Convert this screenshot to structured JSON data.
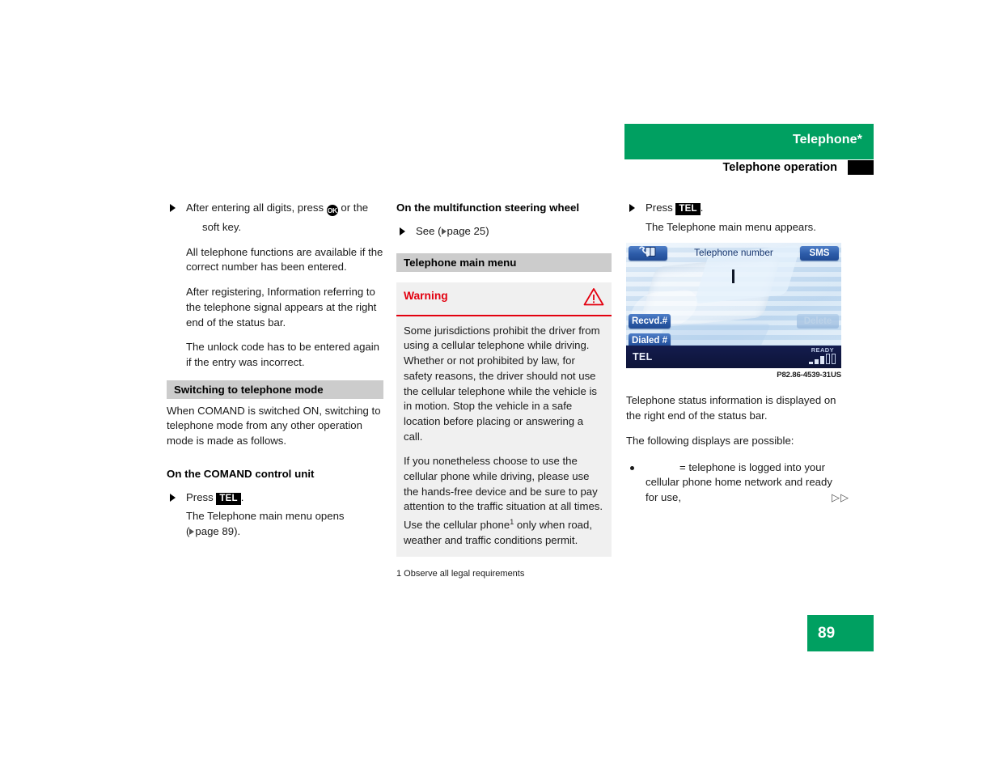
{
  "header": {
    "chapter_title": "Telephone*",
    "section_title": "Telephone operation",
    "green": "#00a061"
  },
  "left_column": {
    "step1": {
      "pre": "After entering all digits, press",
      "key": "OK",
      "post": "or the",
      "line2": "soft key."
    },
    "para1": "All telephone functions are available if the correct number has been entered.",
    "para2": "After registering, Information referring to the telephone signal appears at the right end of the status bar.",
    "para3": "The unlock code has to be entered again if the entry was incorrect.",
    "section_head": "Switching to telephone mode",
    "para4": "When COMAND is switched ON, switching to telephone mode from any other operation mode is made as follows.",
    "sub_head": "On the COMAND control unit",
    "step2": {
      "pre": "Press",
      "key": "TEL",
      "post": "."
    },
    "step2_result_line1": "The Telephone main menu opens",
    "step2_result_line2": "page 89)."
  },
  "middle_column": {
    "head": "On the multifunction steering wheel",
    "see_step": {
      "pre": "See (",
      "post": "page 25)"
    },
    "section_head": "Telephone main menu",
    "warning": {
      "title": "Warning",
      "icon": "warning-triangle-icon",
      "accent": "#e3000f",
      "para1": "Some jurisdictions prohibit the driver from using a cellular telephone while driving. Whether or not prohibited by law, for safety reasons, the driver should not use the cellular telephone while the vehicle is in motion. Stop the vehicle in a safe location before placing or answering a call.",
      "para2_a": "If you nonetheless choose to use the cellular phone while driving, please use the hands-free device and be sure to pay attention to the traffic situation at all times. Use the cellular phone",
      "para2_sup": "1",
      "para2_b": " only when road, weather and traffic conditions permit."
    },
    "footnote": "1 Observe all legal requirements"
  },
  "right_column": {
    "step1": {
      "pre": "Press",
      "key": "TEL",
      "post": "."
    },
    "step1_result": "The Telephone main menu appears.",
    "lcd": {
      "phonebook_icon": "phonebook-icon",
      "title": "Telephone number",
      "sms_label": "SMS",
      "recvd_label": "Recvd.#",
      "dialed_label": "Dialed #",
      "delete_label": "Delete",
      "status_left": "TEL",
      "status_ready": "READY"
    },
    "lcd_caption": "P82.86-4539-31US",
    "para1": "Telephone status information is displayed on the right end of the status bar.",
    "para2": "The following displays are possible:",
    "bullet1": "= telephone is logged into your cellular phone home network and ready for use,",
    "continue_marker": "▷▷"
  },
  "page": {
    "number": "89"
  }
}
